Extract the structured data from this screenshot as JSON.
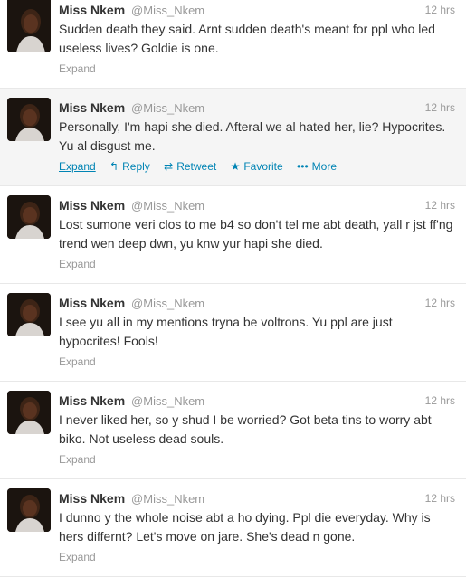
{
  "tweets": [
    {
      "fullname": "Miss Nkem",
      "username": "@Miss_Nkem",
      "time": "12 hrs",
      "text": "Sudden death they said. Arnt sudden death's meant for ppl who led useless lives? Goldie is one.",
      "expand": "Expand"
    },
    {
      "fullname": "Miss Nkem",
      "username": "@Miss_Nkem",
      "time": "12 hrs",
      "text": "Personally, I'm hapi she died. Afteral we al hated her, lie? Hypocrites. Yu al disgust me.",
      "expand": "Expand",
      "actions": {
        "reply": "Reply",
        "retweet": "Retweet",
        "favorite": "Favorite",
        "more": "More"
      }
    },
    {
      "fullname": "Miss Nkem",
      "username": "@Miss_Nkem",
      "time": "12 hrs",
      "text": "Lost sumone veri clos to me b4 so don't tel me abt death, yall r jst ff'ng trend wen deep dwn, yu knw yur hapi she died.",
      "expand": "Expand"
    },
    {
      "fullname": "Miss Nkem",
      "username": "@Miss_Nkem",
      "time": "12 hrs",
      "text": "I see yu all in my mentions tryna be voltrons. Yu ppl are just hypocrites! Fools!",
      "expand": "Expand"
    },
    {
      "fullname": "Miss Nkem",
      "username": "@Miss_Nkem",
      "time": "12 hrs",
      "text": "I never liked her, so y shud I be worried? Got beta tins to worry abt biko. Not useless dead souls.",
      "expand": "Expand"
    },
    {
      "fullname": "Miss Nkem",
      "username": "@Miss_Nkem",
      "time": "12 hrs",
      "text": "I dunno y the whole noise abt a ho dying. Ppl die everyday. Why is hers differnt? Let's move on jare. She's dead n gone.",
      "expand": "Expand"
    }
  ],
  "icons": {
    "reply": "reply-icon",
    "retweet": "retweet-icon",
    "favorite": "star-icon",
    "more": "more-dots-icon"
  },
  "colors": {
    "link": "#0084b4",
    "muted": "#999999",
    "text": "#333333",
    "hover_bg": "#f5f5f5"
  }
}
